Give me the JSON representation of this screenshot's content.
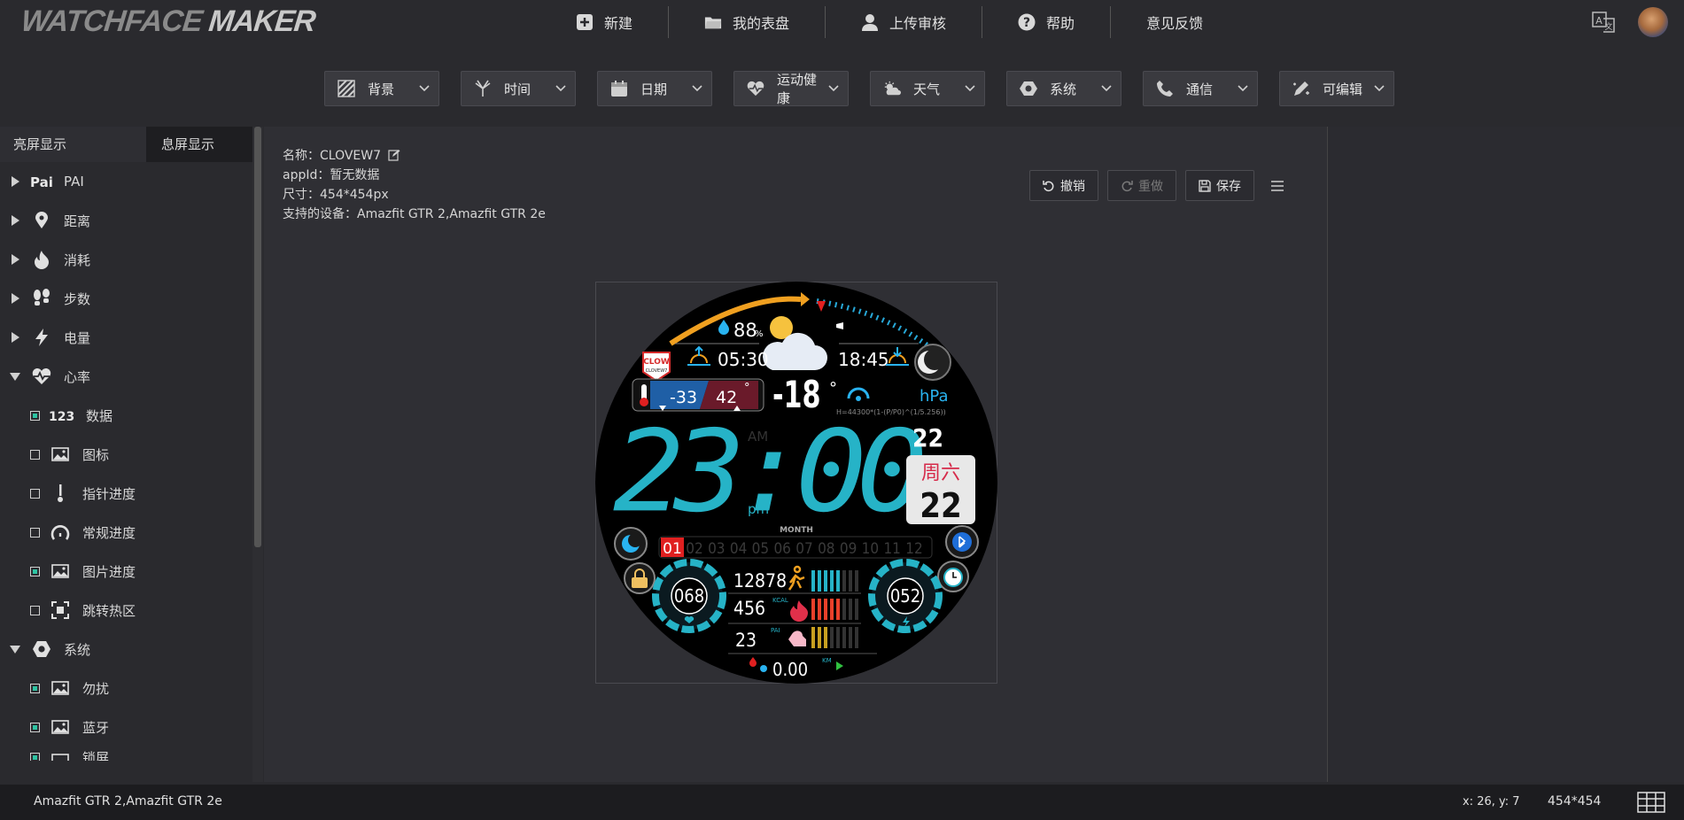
{
  "app": {
    "logo_left": "WATCHFACE",
    "logo_right": "MAKER"
  },
  "nav": [
    {
      "label": "新建",
      "icon": "plus-square-icon"
    },
    {
      "label": "我的表盘",
      "icon": "folder-icon"
    },
    {
      "label": "上传审核",
      "icon": "user-icon"
    },
    {
      "label": "帮助",
      "icon": "question-circle-icon"
    },
    {
      "label": "意见反馈",
      "icon": ""
    }
  ],
  "toolbar": [
    {
      "label": "背景",
      "icon": "background-icon"
    },
    {
      "label": "时间",
      "icon": "time-icon"
    },
    {
      "label": "日期",
      "icon": "calendar-icon"
    },
    {
      "label": "运动健康",
      "icon": "heart-pulse-icon"
    },
    {
      "label": "天气",
      "icon": "weather-icon"
    },
    {
      "label": "系统",
      "icon": "hexagon-icon"
    },
    {
      "label": "通信",
      "icon": "phone-icon"
    },
    {
      "label": "可编辑",
      "icon": "edit-icon"
    }
  ],
  "sidebar": {
    "tabs": [
      "亮屏显示",
      "息屏显示"
    ],
    "items": [
      {
        "label": "PAI",
        "icon": "pai-icon",
        "level": 0,
        "expanded": false
      },
      {
        "label": "距离",
        "icon": "location-pin-icon",
        "level": 0,
        "expanded": false
      },
      {
        "label": "消耗",
        "icon": "flame-icon",
        "level": 0,
        "expanded": false
      },
      {
        "label": "步数",
        "icon": "footprints-icon",
        "level": 0,
        "expanded": false
      },
      {
        "label": "电量",
        "icon": "lightning-icon",
        "level": 0,
        "expanded": false
      },
      {
        "label": "心率",
        "icon": "heart-rate-icon",
        "level": 0,
        "expanded": true
      },
      {
        "label": "数据",
        "icon": "number-123-icon",
        "level": 1,
        "checked": true
      },
      {
        "label": "图标",
        "icon": "image-icon",
        "level": 1,
        "checked": false
      },
      {
        "label": "指针进度",
        "icon": "pointer-icon",
        "level": 1,
        "checked": false
      },
      {
        "label": "常规进度",
        "icon": "gauge-icon",
        "level": 1,
        "checked": false
      },
      {
        "label": "图片进度",
        "icon": "image-icon",
        "level": 1,
        "checked": true
      },
      {
        "label": "跳转热区",
        "icon": "hotzone-icon",
        "level": 1,
        "checked": false
      },
      {
        "label": "系统",
        "icon": "hexagon-icon",
        "level": 0,
        "expanded": true
      },
      {
        "label": "勿扰",
        "icon": "image-icon",
        "level": 1,
        "checked": true
      },
      {
        "label": "蓝牙",
        "icon": "image-icon",
        "level": 1,
        "checked": true
      },
      {
        "label": "锁屏",
        "icon": "image-icon",
        "level": 1,
        "checked": true
      }
    ]
  },
  "info": {
    "name_label": "名称：",
    "name_value": "CLOVEW7",
    "appid_label": "appId：",
    "appid_value": "暂无数据",
    "size_label": "尺寸：",
    "size_value": "454*454px",
    "devices_label": "支持的设备：",
    "devices_value": "Amazfit GTR 2,Amazfit GTR 2e"
  },
  "actions": {
    "undo": "撤销",
    "redo": "重做",
    "save": "保存"
  },
  "watch": {
    "humidity": "88",
    "humidity_unit": "%",
    "sunrise": "05:30",
    "sunset": "18:45",
    "logo_text": "CLOW",
    "logo_sub": "CLOVEW7",
    "temp_low": "-33",
    "temp_high": "42",
    "temp_deg": "°",
    "temp_current": "-18",
    "temp_current_unit": "°",
    "pressure_unit": "hPa",
    "formula": "H=44300*(1-(P/P0)^(1/5.256))",
    "time": "23:00",
    "am": "AM",
    "pm": "pm",
    "day_small": "22",
    "weekday": "周六",
    "day_big": "22",
    "month_label": "MONTH",
    "month_current": "01",
    "months": [
      "02",
      "03",
      "04",
      "05",
      "06",
      "07",
      "08",
      "09",
      "10",
      "11",
      "12"
    ],
    "steps": "12878",
    "calories": "456",
    "kcal": "KCAL",
    "pai": "23",
    "pai_label": "PAI",
    "distance": "0.00",
    "km": "KM",
    "left_gauge": "068",
    "right_gauge": "052"
  },
  "status": {
    "devices": "Amazfit GTR 2,Amazfit GTR 2e",
    "coords": "x: 26, y: 7",
    "size": "454*454"
  }
}
